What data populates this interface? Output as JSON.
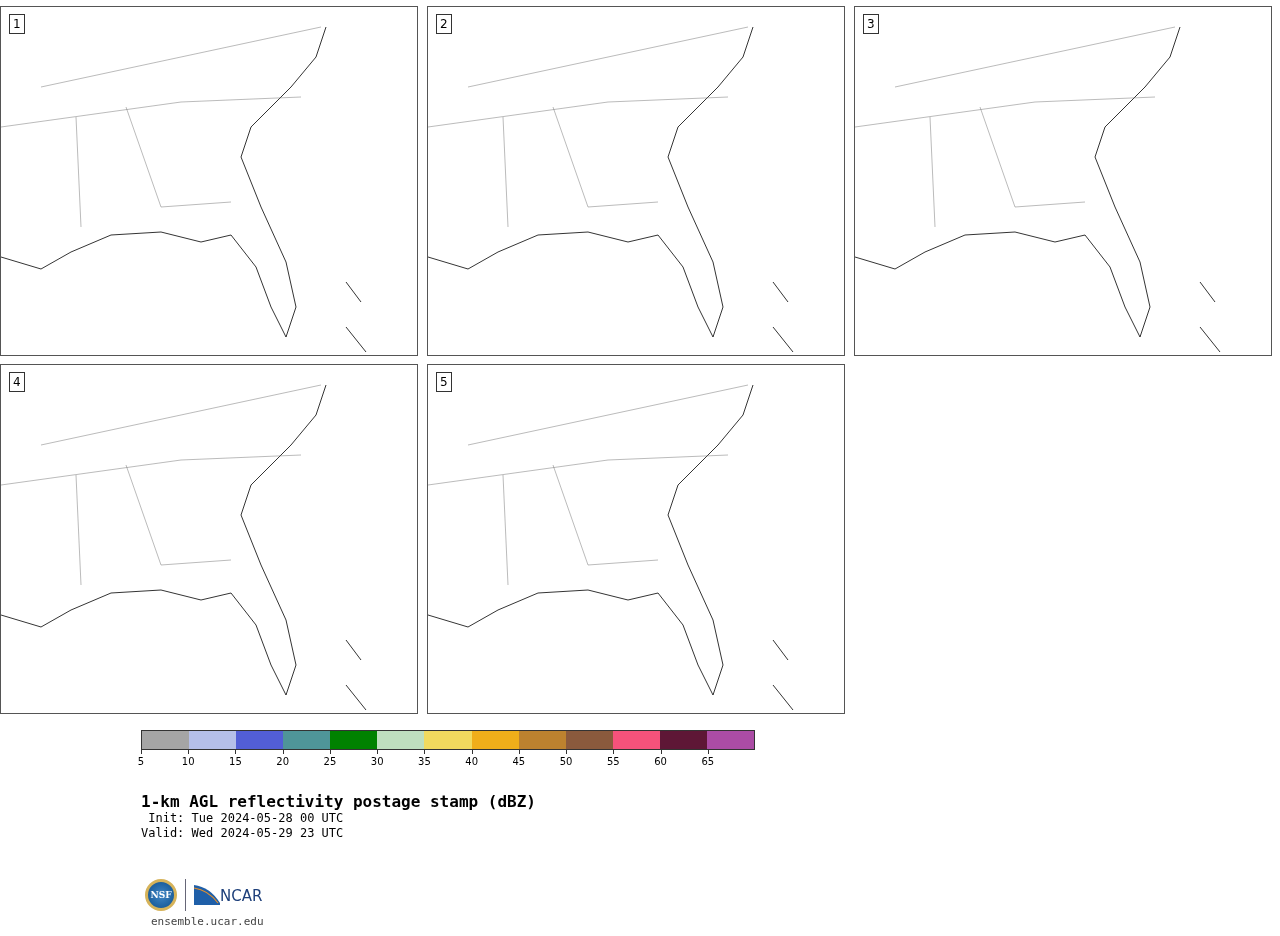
{
  "panels": [
    {
      "label": "1"
    },
    {
      "label": "2"
    },
    {
      "label": "3"
    },
    {
      "label": "4"
    },
    {
      "label": "5"
    }
  ],
  "colorbar": {
    "segments": [
      {
        "color": "#a5a5a5"
      },
      {
        "color": "#b5bfe9"
      },
      {
        "color": "#525ed6"
      },
      {
        "color": "#4f9599"
      },
      {
        "color": "#008200"
      },
      {
        "color": "#bedfbe"
      },
      {
        "color": "#f1da5e"
      },
      {
        "color": "#f0ae1a"
      },
      {
        "color": "#bc822f"
      },
      {
        "color": "#8a5a3d"
      },
      {
        "color": "#f5527b"
      },
      {
        "color": "#5e1736"
      },
      {
        "color": "#ab4ca5"
      }
    ],
    "ticks": [
      "5",
      "10",
      "15",
      "20",
      "25",
      "30",
      "35",
      "40",
      "45",
      "50",
      "55",
      "60",
      "65"
    ]
  },
  "title": "1-km AGL reflectivity postage stamp (dBZ)",
  "init": " Init: Tue 2024-05-28 00 UTC",
  "valid": "Valid: Wed 2024-05-29 23 UTC",
  "logos": {
    "left": "NSF",
    "right": "NCAR"
  },
  "url": "ensemble.ucar.edu"
}
